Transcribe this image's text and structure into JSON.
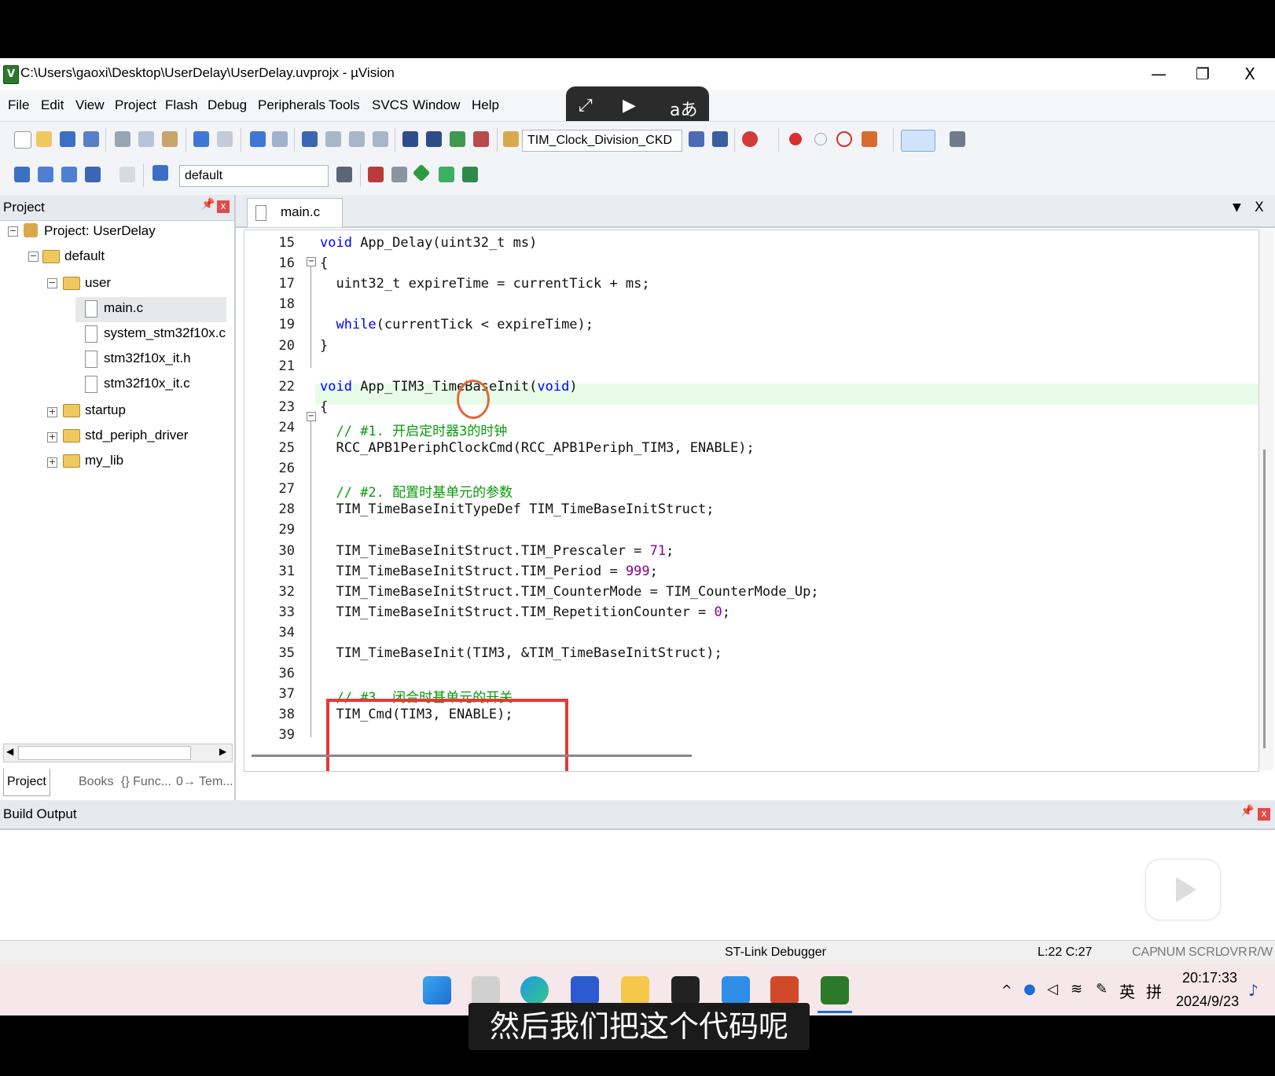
{
  "window": {
    "title": "C:\\Users\\gaoxi\\Desktop\\UserDelay\\UserDelay.uvprojx - µVision",
    "minimize": "—",
    "restore": "❐",
    "close": "X"
  },
  "menu": [
    "File",
    "Edit",
    "View",
    "Project",
    "Flash",
    "Debug",
    "Peripherals",
    "Tools",
    "SVCS",
    "Window",
    "Help"
  ],
  "overlay": {
    "icon1": "⤢",
    "icon2": "▶",
    "icon3": "aあ"
  },
  "toolbar": {
    "find_combo": "TIM_Clock_Division_CKD",
    "target_combo": "default"
  },
  "project_panel": {
    "header": "Project",
    "pin": "ᵖ",
    "close": "x",
    "tree": [
      {
        "label": "Project: UserDelay",
        "level": 0,
        "type": "root",
        "toggle": "−"
      },
      {
        "label": "default",
        "level": 1,
        "type": "folder",
        "toggle": "−"
      },
      {
        "label": "user",
        "level": 2,
        "type": "folder",
        "toggle": "−"
      },
      {
        "label": "main.c",
        "level": 3,
        "type": "file"
      },
      {
        "label": "system_stm32f10x.c",
        "level": 3,
        "type": "file"
      },
      {
        "label": "stm32f10x_it.h",
        "level": 3,
        "type": "file"
      },
      {
        "label": "stm32f10x_it.c",
        "level": 3,
        "type": "file"
      },
      {
        "label": "startup",
        "level": 2,
        "type": "folder",
        "toggle": "+"
      },
      {
        "label": "std_periph_driver",
        "level": 2,
        "type": "folder",
        "toggle": "+"
      },
      {
        "label": "my_lib",
        "level": 2,
        "type": "folder",
        "toggle": "+"
      }
    ],
    "bottom_tabs": [
      "Project",
      "Books",
      "{} Func...",
      "0→ Tem..."
    ]
  },
  "editor": {
    "tab": "main.c",
    "menu_arrow": "▼",
    "close": "X",
    "cursor": "L:22 C:27",
    "lines": [
      {
        "n": "15",
        "code": "void App_Delay(uint32_t ms)"
      },
      {
        "n": "16",
        "code": "{"
      },
      {
        "n": "17",
        "code": "  uint32_t expireTime = currentTick + ms;"
      },
      {
        "n": "18",
        "code": ""
      },
      {
        "n": "19",
        "code": "  while(currentTick < expireTime);"
      },
      {
        "n": "20",
        "code": "}"
      },
      {
        "n": "21",
        "code": ""
      },
      {
        "n": "22",
        "code": "void App_TIM3_TimeBaseInit(void)"
      },
      {
        "n": "23",
        "code": "{"
      },
      {
        "n": "24",
        "code": "  // #1. 开启定时器3的时钟"
      },
      {
        "n": "25",
        "code": "  RCC_APB1PeriphClockCmd(RCC_APB1Periph_TIM3, ENABLE);"
      },
      {
        "n": "26",
        "code": ""
      },
      {
        "n": "27",
        "code": "  // #2. 配置时基单元的参数"
      },
      {
        "n": "28",
        "code": "  TIM_TimeBaseInitTypeDef TIM_TimeBaseInitStruct;"
      },
      {
        "n": "29",
        "code": ""
      },
      {
        "n": "30",
        "code": "  TIM_TimeBaseInitStruct.TIM_Prescaler = 71;"
      },
      {
        "n": "31",
        "code": "  TIM_TimeBaseInitStruct.TIM_Period = 999;"
      },
      {
        "n": "32",
        "code": "  TIM_TimeBaseInitStruct.TIM_CounterMode = TIM_CounterMode_Up;"
      },
      {
        "n": "33",
        "code": "  TIM_TimeBaseInitStruct.TIM_RepetitionCounter = 0;"
      },
      {
        "n": "34",
        "code": ""
      },
      {
        "n": "35",
        "code": "  TIM_TimeBaseInit(TIM3, &TIM_TimeBaseInitStruct);"
      },
      {
        "n": "36",
        "code": ""
      },
      {
        "n": "37",
        "code": "  // #3. 闭合时基单元的开关"
      },
      {
        "n": "38",
        "code": "  TIM_Cmd(TIM3, ENABLE);"
      },
      {
        "n": "39",
        "code": ""
      }
    ]
  },
  "build_output": {
    "header": "Build Output"
  },
  "status": {
    "debugger": "ST-Link Debugger",
    "position": "L:22 C:27",
    "flags": [
      "CAP",
      "NUM",
      "SCRL",
      "OVR",
      "R/W"
    ]
  },
  "taskbar": {
    "time": "20:17:33",
    "date": "2024/9/23",
    "ime_lang": "英",
    "ime_mode": "拼"
  },
  "subtitle": "然后我们把这个代码呢",
  "colors": {
    "keyword": "#0000ff",
    "comment": "#0a9a0a",
    "number": "#8a008a",
    "highlight_box": "#e53935"
  }
}
